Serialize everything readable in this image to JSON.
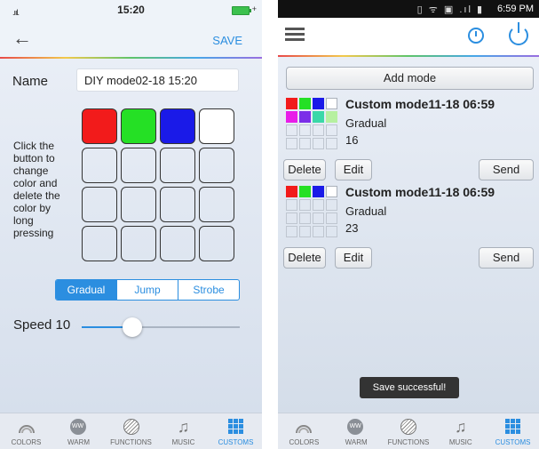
{
  "left": {
    "status": {
      "signal": ".ııl.",
      "time": "15:20"
    },
    "nav": {
      "save": "SAVE"
    },
    "name_label": "Name",
    "name_value": "DIY mode02-18 15:20",
    "hint": "Click the button to change color and delete the color by long pressing",
    "grid_colors": [
      "#f21b1b",
      "#25e025",
      "#1a1ae8",
      "#ffffff",
      "",
      "",
      "",
      "",
      "",
      "",
      "",
      "",
      "",
      "",
      "",
      ""
    ],
    "mode_tabs": [
      "Gradual",
      "Jump",
      "Strobe"
    ],
    "active_mode": "Gradual",
    "speed_label": "Speed 10",
    "speed_fraction": 0.32
  },
  "right": {
    "status": {
      "icons": "▯ ᯤ ▣ .ıl ▮",
      "time": "6:59 PM"
    },
    "add_mode": "Add mode",
    "modes": [
      {
        "title": "Custom mode11-18 06:59",
        "type": "Gradual",
        "speed": "16",
        "colors": [
          "#f21b1b",
          "#25e025",
          "#1a1ae8",
          "#ffffff",
          "#e81ee8",
          "#7b2ee8",
          "#3ad8a8",
          "#b6f0a0",
          "",
          "",
          "",
          "",
          "",
          "",
          "",
          ""
        ]
      },
      {
        "title": "Custom mode11-18 06:59",
        "type": "Gradual",
        "speed": "23",
        "colors": [
          "#f21b1b",
          "#25e025",
          "#1a1ae8",
          "#ffffff",
          "",
          "",
          "",
          "",
          "",
          "",
          "",
          "",
          "",
          "",
          "",
          ""
        ]
      }
    ],
    "buttons": {
      "delete": "Delete",
      "edit": "Edit",
      "send": "Send"
    },
    "toast": "Save successful!"
  },
  "tabbar": {
    "tabs": [
      {
        "label": "COLORS",
        "icon": "rainbow-icon"
      },
      {
        "label": "WARM",
        "icon": "ww-icon",
        "badge": "WW"
      },
      {
        "label": "FUNCTIONS",
        "icon": "functions-icon"
      },
      {
        "label": "MUSIC",
        "icon": "music-note-icon",
        "glyph": "♫"
      },
      {
        "label": "CUSTOMS",
        "icon": "customs-grid-icon"
      }
    ],
    "active": "CUSTOMS"
  },
  "accent_color": "#2b8ee0"
}
